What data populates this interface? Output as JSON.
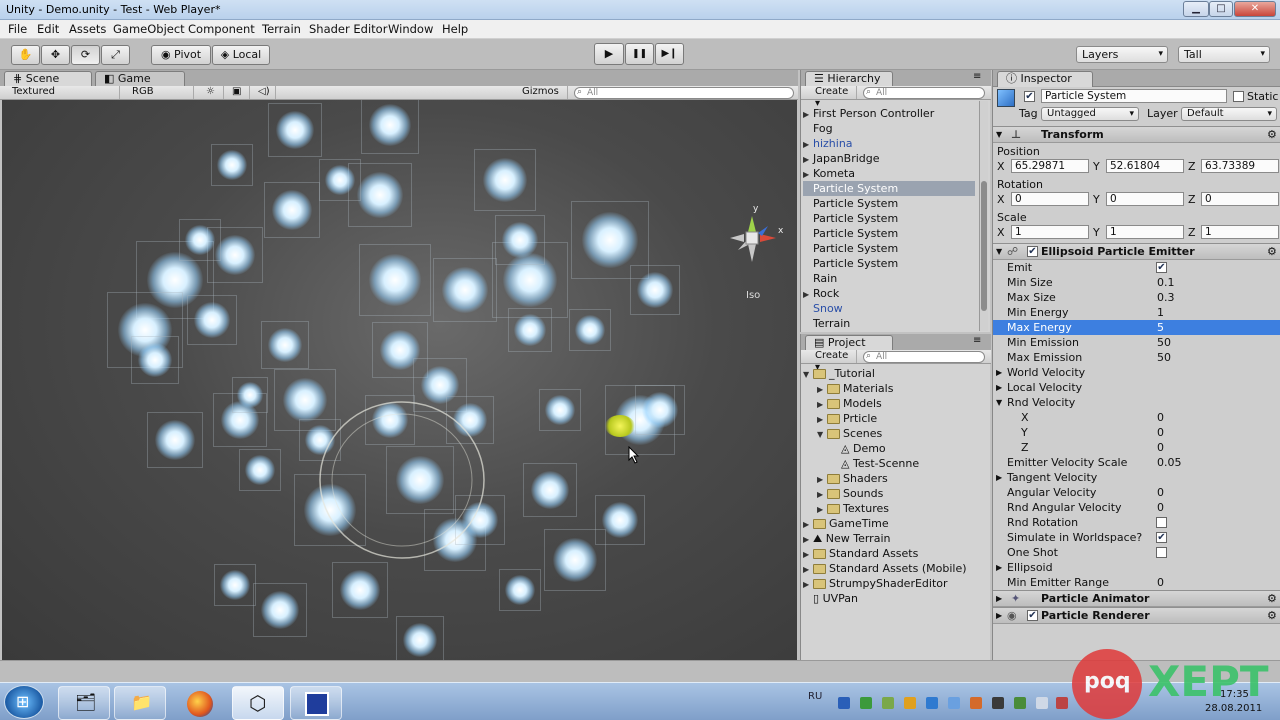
{
  "window": {
    "title": "Unity - Demo.unity - Test - Web Player*",
    "min": "▁",
    "max": "□",
    "close": "✕"
  },
  "menu": [
    "File",
    "Edit",
    "Assets",
    "GameObject",
    "Component",
    "Terrain",
    "Shader Editor",
    "Window",
    "Help"
  ],
  "toolbar": {
    "tool_icons": [
      "hand-icon",
      "move-icon",
      "rotate-icon",
      "scale-icon"
    ],
    "pivot": "Pivot",
    "local": "Local",
    "play": "▶",
    "pause": "❚❚",
    "step": "▶❙",
    "layers": "Layers",
    "layout": "Tall"
  },
  "scene": {
    "tab_scene": "Scene",
    "tab_game": "Game",
    "render_mode": "Textured",
    "color_mode": "RGB",
    "gizmos": "Gizmos",
    "search_placeholder": "All",
    "gizmo_y": "y",
    "gizmo_x": "x",
    "gizmo_mode": "Iso"
  },
  "hierarchy": {
    "tab": "Hierarchy",
    "create": "Create",
    "search_placeholder": "All",
    "items": [
      {
        "label": "First Person Controller",
        "expandable": true,
        "selected": false,
        "color": "#111"
      },
      {
        "label": "Fog",
        "expandable": false,
        "selected": false,
        "color": "#111"
      },
      {
        "label": "hizhina",
        "expandable": true,
        "selected": false,
        "color": "#2a4fa8"
      },
      {
        "label": "JapanBridge",
        "expandable": true,
        "selected": false,
        "color": "#111"
      },
      {
        "label": "Kometa",
        "expandable": true,
        "selected": false,
        "color": "#111"
      },
      {
        "label": "Particle System",
        "expandable": false,
        "selected": true,
        "color": "#fff"
      },
      {
        "label": "Particle System",
        "expandable": false,
        "selected": false,
        "color": "#111"
      },
      {
        "label": "Particle System",
        "expandable": false,
        "selected": false,
        "color": "#111"
      },
      {
        "label": "Particle System",
        "expandable": false,
        "selected": false,
        "color": "#111"
      },
      {
        "label": "Particle System",
        "expandable": false,
        "selected": false,
        "color": "#111"
      },
      {
        "label": "Particle System",
        "expandable": false,
        "selected": false,
        "color": "#111"
      },
      {
        "label": "Rain",
        "expandable": false,
        "selected": false,
        "color": "#111"
      },
      {
        "label": "Rock",
        "expandable": true,
        "selected": false,
        "color": "#111"
      },
      {
        "label": "Snow",
        "expandable": false,
        "selected": false,
        "color": "#2a4fa8"
      },
      {
        "label": "Terrain",
        "expandable": false,
        "selected": false,
        "color": "#111"
      }
    ]
  },
  "project": {
    "tab": "Project",
    "create": "Create",
    "search_placeholder": "All",
    "items": [
      {
        "label": "_Tutorial",
        "indent": 0,
        "arrow": "▼",
        "kind": "folder"
      },
      {
        "label": "Materials",
        "indent": 1,
        "arrow": "▶",
        "kind": "folder"
      },
      {
        "label": "Models",
        "indent": 1,
        "arrow": "▶",
        "kind": "folder"
      },
      {
        "label": "Prticle",
        "indent": 1,
        "arrow": "▶",
        "kind": "folder"
      },
      {
        "label": "Scenes",
        "indent": 1,
        "arrow": "▼",
        "kind": "folder"
      },
      {
        "label": "Demo",
        "indent": 2,
        "arrow": "",
        "kind": "scene"
      },
      {
        "label": "Test-Scenne",
        "indent": 2,
        "arrow": "",
        "kind": "scene"
      },
      {
        "label": "Shaders",
        "indent": 1,
        "arrow": "▶",
        "kind": "folder"
      },
      {
        "label": "Sounds",
        "indent": 1,
        "arrow": "▶",
        "kind": "folder"
      },
      {
        "label": "Textures",
        "indent": 1,
        "arrow": "▶",
        "kind": "folder"
      },
      {
        "label": "GameTime",
        "indent": 0,
        "arrow": "▶",
        "kind": "folder"
      },
      {
        "label": "New Terrain",
        "indent": 0,
        "arrow": "▶",
        "kind": "terrain"
      },
      {
        "label": "Standard Assets",
        "indent": 0,
        "arrow": "▶",
        "kind": "folder"
      },
      {
        "label": "Standard Assets (Mobile)",
        "indent": 0,
        "arrow": "▶",
        "kind": "folder"
      },
      {
        "label": "StrumpyShaderEditor",
        "indent": 0,
        "arrow": "▶",
        "kind": "folder"
      },
      {
        "label": "UVPan",
        "indent": 0,
        "arrow": "",
        "kind": "file"
      }
    ]
  },
  "inspector": {
    "tab": "Inspector",
    "object_name": "Particle System",
    "static_label": "Static",
    "tag_label": "Tag",
    "tag_value": "Untagged",
    "layer_label": "Layer",
    "layer_value": "Default",
    "transform": {
      "title": "Transform",
      "position_label": "Position",
      "rotation_label": "Rotation",
      "scale_label": "Scale",
      "axis_x": "X",
      "axis_y": "Y",
      "axis_z": "Z",
      "position": [
        "65.29871",
        "52.61804",
        "63.73389"
      ],
      "rotation": [
        "0",
        "0",
        "0"
      ],
      "scale": [
        "1",
        "1",
        "1"
      ]
    },
    "emitter": {
      "title": "Ellipsoid Particle Emitter",
      "props": [
        {
          "label": "Emit",
          "type": "check",
          "value": "✔",
          "checked": true
        },
        {
          "label": "Min Size",
          "type": "text",
          "value": "0.1"
        },
        {
          "label": "Max Size",
          "type": "text",
          "value": "0.3"
        },
        {
          "label": "Min Energy",
          "type": "text",
          "value": "1"
        },
        {
          "label": "Max Energy",
          "type": "text",
          "value": "5",
          "selected": true
        },
        {
          "label": "Min Emission",
          "type": "text",
          "value": "50"
        },
        {
          "label": "Max Emission",
          "type": "text",
          "value": "50"
        },
        {
          "label": "World Velocity",
          "type": "fold",
          "value": ""
        },
        {
          "label": "Local Velocity",
          "type": "fold",
          "value": ""
        },
        {
          "label": "Rnd Velocity",
          "type": "foldopen",
          "value": ""
        },
        {
          "label": "X",
          "type": "sub",
          "value": "0"
        },
        {
          "label": "Y",
          "type": "sub",
          "value": "0"
        },
        {
          "label": "Z",
          "type": "sub",
          "value": "0"
        },
        {
          "label": "Emitter Velocity Scale",
          "type": "text",
          "value": "0.05"
        },
        {
          "label": "Tangent Velocity",
          "type": "fold",
          "value": ""
        },
        {
          "label": "Angular Velocity",
          "type": "text",
          "value": "0"
        },
        {
          "label": "Rnd Angular Velocity",
          "type": "text",
          "value": "0"
        },
        {
          "label": "Rnd Rotation",
          "type": "check",
          "value": "",
          "checked": false
        },
        {
          "label": "Simulate in Worldspace?",
          "type": "check",
          "value": "✔",
          "checked": true
        },
        {
          "label": "One Shot",
          "type": "check",
          "value": "",
          "checked": false
        },
        {
          "label": "Ellipsoid",
          "type": "fold",
          "value": ""
        },
        {
          "label": "Min Emitter Range",
          "type": "text",
          "value": "0"
        }
      ]
    },
    "animator": {
      "title": "Particle Animator"
    },
    "renderer": {
      "title": "Particle Renderer"
    },
    "gear": "⚙"
  },
  "taskbar": {
    "lang": "RU",
    "time": "17:35",
    "date": "28.08.2011",
    "watermark_left": "poq",
    "watermark_right": "XEPT"
  }
}
